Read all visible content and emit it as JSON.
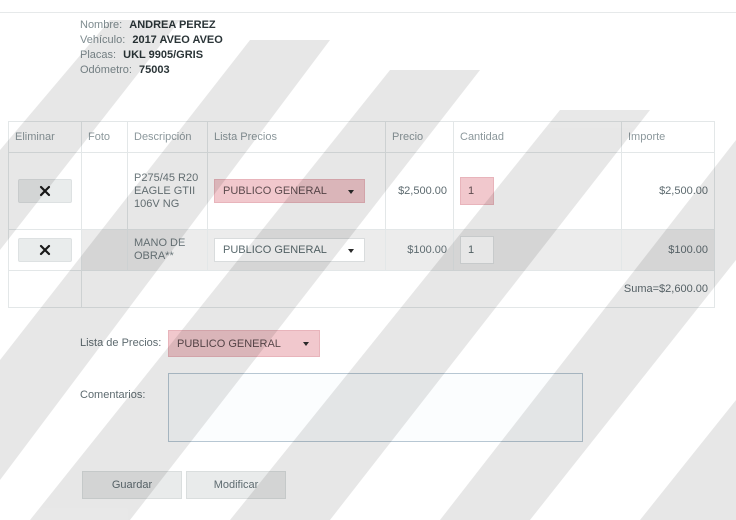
{
  "customer": {
    "name_label": "Nombre:",
    "name": "ANDREA PEREZ",
    "vehicle_label": "Vehículo:",
    "vehicle": "2017 AVEO AVEO",
    "plates_label": "Placas:",
    "plates": "UKL 9905/GRIS",
    "odometer_label": "Odómetro:",
    "odometer": "75003"
  },
  "table": {
    "headers": [
      "Eliminar",
      "Foto",
      "Descripción",
      "Lista Precios",
      "Precio",
      "Cantidad",
      "Importe"
    ],
    "rows": [
      {
        "description": "P275/45 R20 EAGLE GTII 106V NG",
        "price_list": "PUBLICO GENERAL",
        "price": "$2,500.00",
        "quantity": "1",
        "amount": "$2,500.00"
      },
      {
        "description": "MANO DE OBRA**",
        "price_list": "PUBLICO GENERAL",
        "price": "$100.00",
        "quantity": "1",
        "amount": "$100.00"
      }
    ],
    "sum": "Suma=$2,600.00"
  },
  "price_list": {
    "label": "Lista de Precios:",
    "value": "PUBLICO GENERAL"
  },
  "comments": {
    "label": "Comentarios:",
    "value": ""
  },
  "buttons": {
    "save": "Guardar",
    "edit": "Modificar"
  },
  "colors": {
    "highlight_pink": "#f1c8cd",
    "row_gray": "#ececec"
  }
}
